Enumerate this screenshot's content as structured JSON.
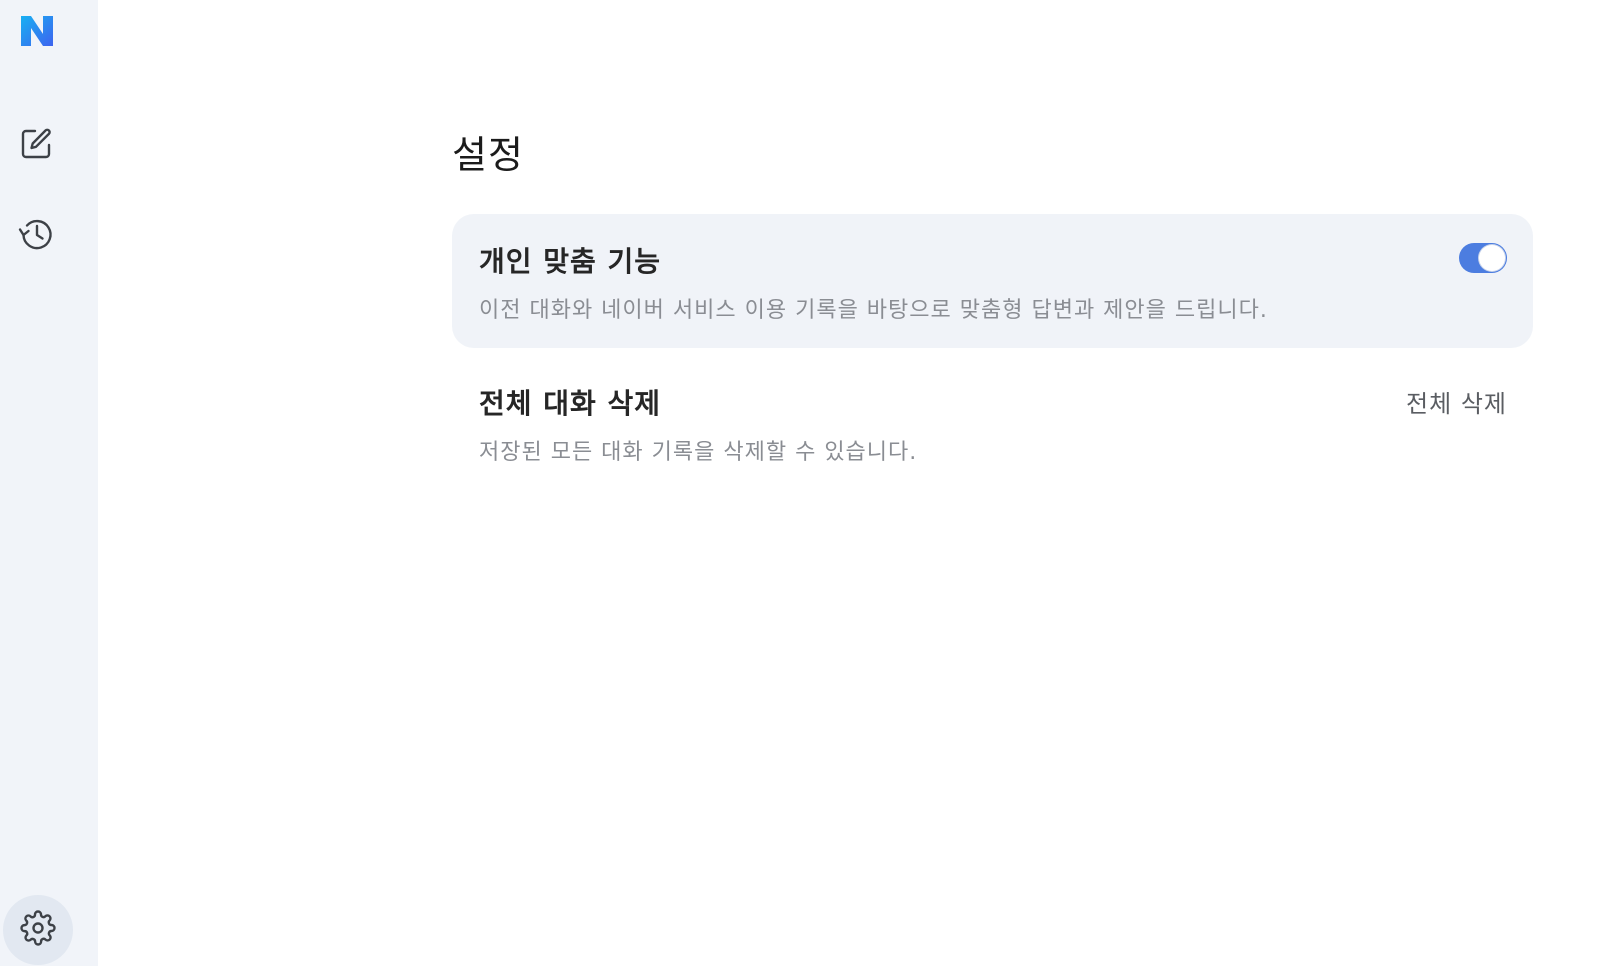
{
  "sidebar": {
    "logo_icon": "naver-n-logo",
    "items": [
      {
        "icon": "edit-icon",
        "name": "new-chat"
      },
      {
        "icon": "history-icon",
        "name": "history"
      },
      {
        "icon": "gear-icon",
        "name": "settings"
      }
    ]
  },
  "main": {
    "title": "설정",
    "options": [
      {
        "title": "개인 맞춤 기능",
        "description": "이전 대화와 네이버 서비스 이용 기록을 바탕으로 맞춤형 답변과 제안을 드립니다.",
        "toggle_on": true
      },
      {
        "title": "전체 대화 삭제",
        "description": "저장된 모든 대화 기록을 삭제할 수 있습니다.",
        "action_label": "전체 삭제"
      }
    ]
  },
  "colors": {
    "accent": "#4c7de0",
    "sidebar_bg": "#f1f4f9",
    "card_bg": "#f0f3f8",
    "logo_gradient_start": "#1aa6f0",
    "logo_gradient_end": "#3a6af0"
  }
}
